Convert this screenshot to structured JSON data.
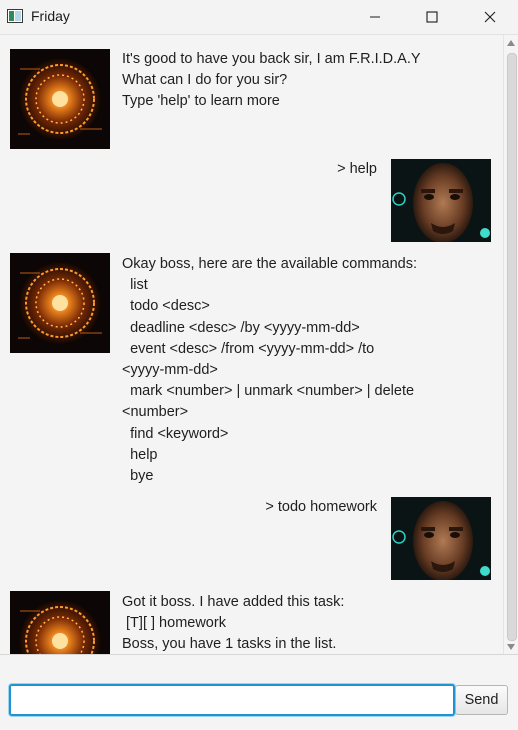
{
  "window": {
    "title": "Friday"
  },
  "conversation": [
    {
      "speaker": "friday",
      "avatar": "arc-reactor-avatar",
      "text": "It's good to have you back sir, I am F.R.I.D.A.Y\nWhat can I do for you sir?\nType 'help' to learn more"
    },
    {
      "speaker": "user",
      "avatar": "user-portrait-avatar",
      "text": "> help"
    },
    {
      "speaker": "friday",
      "avatar": "arc-reactor-avatar",
      "text": "Okay boss, here are the available commands:\n  list\n  todo <desc>\n  deadline <desc> /by <yyyy-mm-dd>\n  event <desc> /from <yyyy-mm-dd> /to\n<yyyy-mm-dd>\n  mark <number> | unmark <number> | delete\n<number>\n  find <keyword>\n  help\n  bye"
    },
    {
      "speaker": "user",
      "avatar": "user-portrait-avatar",
      "text": "> todo homework"
    },
    {
      "speaker": "friday",
      "avatar": "arc-reactor-avatar",
      "text": "Got it boss. I have added this task:\n [T][ ] homework\nBoss, you have 1 tasks in the list."
    }
  ],
  "input": {
    "value": "",
    "placeholder": ""
  },
  "send_button": {
    "label": "Send"
  },
  "colors": {
    "input_focus": "#1f94d1",
    "background": "#f4f4f4"
  }
}
